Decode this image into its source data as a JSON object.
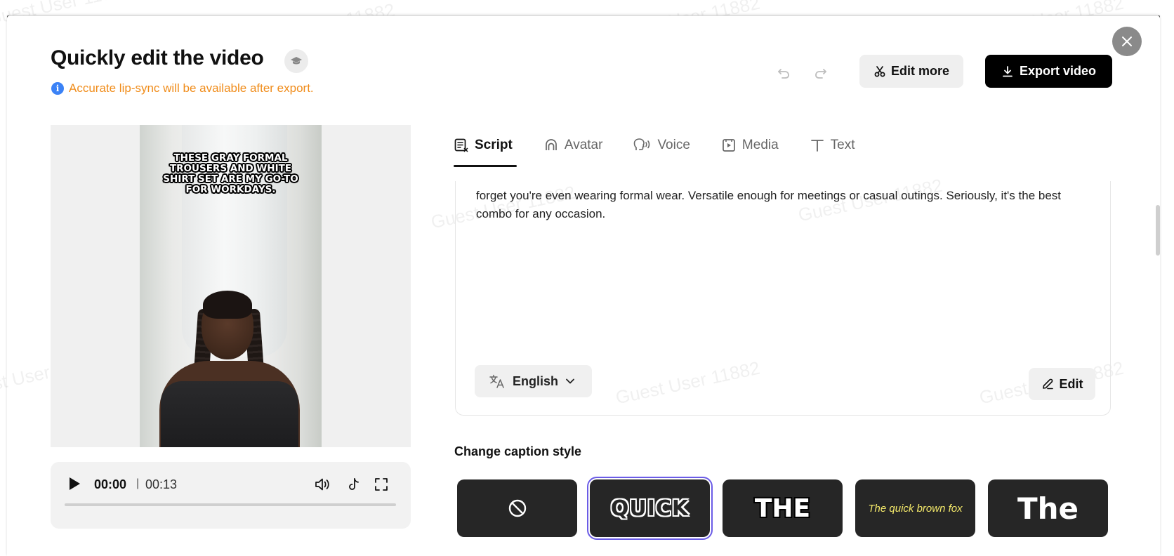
{
  "watermark_text": "Guest User 11882",
  "header": {
    "title": "Quickly edit the video",
    "notice": "Accurate lip-sync will be available after export.",
    "edit_more_label": "Edit more",
    "export_label": "Export video"
  },
  "video": {
    "caption_overlay": "THESE GRAY FORMAL TROUSERS AND WHITE SHIRT SET ARE MY GO-TO FOR WORKDAYS.",
    "current_time": "00:00",
    "separator": "|",
    "total_time": "00:13",
    "progress": 0
  },
  "tabs": [
    {
      "label": "Script",
      "icon": "script-icon",
      "active": true
    },
    {
      "label": "Avatar",
      "icon": "avatar-icon",
      "active": false
    },
    {
      "label": "Voice",
      "icon": "voice-icon",
      "active": false
    },
    {
      "label": "Media",
      "icon": "media-icon",
      "active": false
    },
    {
      "label": "Text",
      "icon": "text-icon",
      "active": false
    }
  ],
  "script": {
    "text": "forget you're even wearing formal wear. Versatile enough for meetings or casual outings. Seriously, it's the best combo for any occasion.",
    "language": "English",
    "edit_label": "Edit"
  },
  "caption_styles": {
    "heading": "Change caption style",
    "options": [
      {
        "label": "",
        "icon": "no-caption-icon",
        "selected": false
      },
      {
        "label": "QUICK",
        "selected": true
      },
      {
        "label": "THE",
        "selected": false
      },
      {
        "label": "The quick brown fox",
        "selected": false
      },
      {
        "label": "The",
        "selected": false
      }
    ]
  },
  "colors": {
    "notice": "#f08c1a",
    "info": "#3b82f6",
    "selected_outline": "#6b5ce6",
    "export_bg": "#000000"
  }
}
